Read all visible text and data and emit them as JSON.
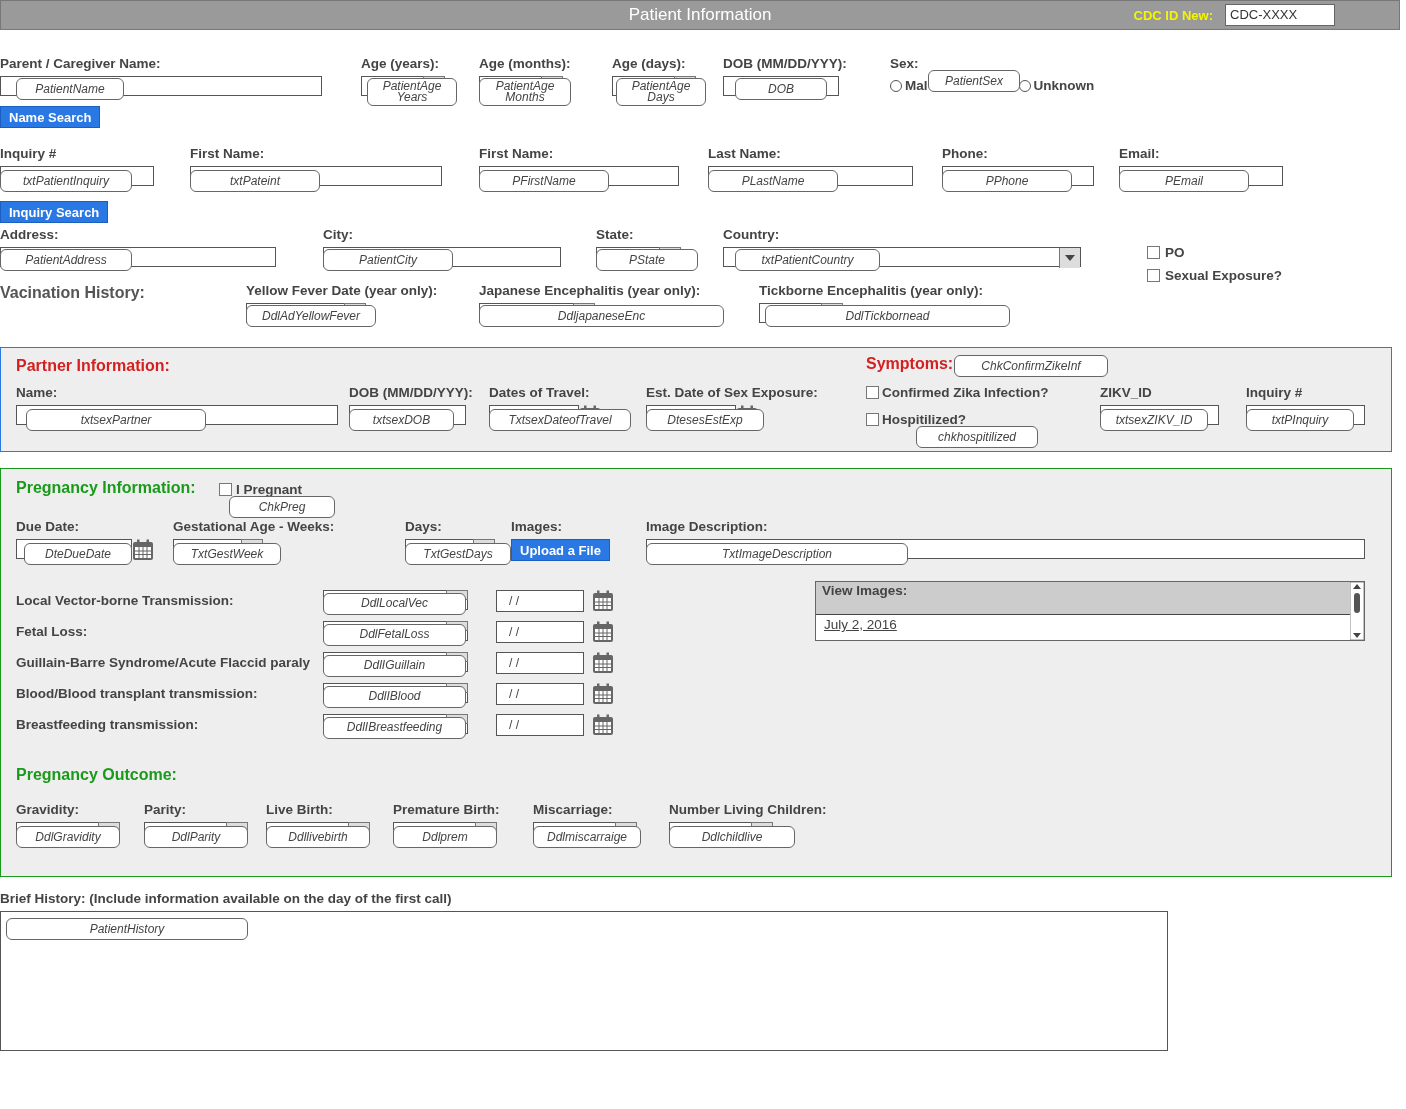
{
  "header": {
    "title": "Patient Information",
    "cdc_label": "CDC ID New:",
    "cdc_value": "CDC-XXXX"
  },
  "patient_row_1": [
    {
      "label": "Parent / Caregiver Name:",
      "kind": "text",
      "callout": "PatientName"
    },
    {
      "label": "Age (years):",
      "kind": "dropdown",
      "callout": "PatientAge Years"
    },
    {
      "label": "Age (months):",
      "kind": "dropdown",
      "callout": "PatientAge Months"
    },
    {
      "label": "Age (days):",
      "kind": "dropdown",
      "callout": "PatientAge Days"
    },
    {
      "label": "DOB (MM/DD/YYY):",
      "kind": "text",
      "callout": "DOB"
    }
  ],
  "sex": {
    "label": "Sex:",
    "callout": "PatientSex",
    "options": [
      {
        "label": "Mal",
        "selected": false
      },
      {
        "label": "Unknown",
        "selected": false
      }
    ]
  },
  "name_search_button": "Name Search",
  "patient_row_2": [
    {
      "label": "Inquiry #",
      "kind": "text",
      "callout": "txtPatientInquiry"
    },
    {
      "label": "First Name:",
      "kind": "text",
      "callout": "txtPateint"
    },
    {
      "label": "First Name:",
      "kind": "text",
      "callout": "PFirstName"
    },
    {
      "label": "Last Name:",
      "kind": "text",
      "callout": "PLastName"
    },
    {
      "label": "Phone:",
      "kind": "text",
      "callout": "PPhone"
    },
    {
      "label": "Email:",
      "kind": "text",
      "callout": "PEmail"
    }
  ],
  "inquiry_search_button": "Inquiry Search",
  "patient_row_3": [
    {
      "label": "Address:",
      "kind": "text",
      "callout": "PatientAddress"
    },
    {
      "label": "City:",
      "kind": "text",
      "callout": "PatientCity"
    },
    {
      "label": "State:",
      "kind": "dropdown",
      "callout": "PState"
    },
    {
      "label": "Country:",
      "kind": "select",
      "callout": "txtPatientCountry"
    }
  ],
  "patient_checks": [
    {
      "label": "PO",
      "checked": false
    },
    {
      "label": "Sexual Exposure?",
      "checked": false
    }
  ],
  "vaccination": {
    "title": "Vacination History:",
    "fields": [
      {
        "label": "Yellow Fever Date (year only):",
        "kind": "dropdown",
        "callout": "DdlAdYellowFever"
      },
      {
        "label": "Japanese Encephalitis (year only):",
        "kind": "dropdown",
        "callout": "DdljapaneseEnc"
      },
      {
        "label": "Tickborne Encephalitis (year only):",
        "kind": "dropdown",
        "callout": "DdlTickbornead"
      }
    ]
  },
  "partner": {
    "title": "Partner Information:",
    "fields": [
      {
        "label": "Name:",
        "kind": "text",
        "callout": "txtsexPartner"
      },
      {
        "label": "DOB (MM/DD/YYY):",
        "kind": "text",
        "callout": "txtsexDOB"
      },
      {
        "label": "Dates of Travel:",
        "kind": "date",
        "callout": "TxtsexDateofTravel"
      },
      {
        "label": "Est. Date of Sex Exposure:",
        "kind": "date",
        "callout": "DtesesEstExp"
      }
    ],
    "symptoms": {
      "title": "Symptoms:",
      "items": [
        {
          "label": "Confirmed Zika Infection?",
          "checked": false,
          "callout": "ChkConfirmZikeInf"
        },
        {
          "label": "Hospitilized?",
          "checked": false,
          "callout": "chkhospitilized"
        }
      ]
    },
    "id_fields": [
      {
        "label": "ZIKV_ID",
        "kind": "text",
        "callout": "txtsexZIKV_ID"
      },
      {
        "label": "Inquiry #",
        "kind": "text",
        "callout": "txtPInquiry"
      }
    ]
  },
  "pregnancy": {
    "title": "Pregnancy Information:",
    "pregnant": {
      "label": "I Pregnant",
      "checked": false,
      "callout": "ChkPreg"
    },
    "fields": [
      {
        "label": "Due Date:",
        "kind": "date",
        "callout": "DteDueDate"
      },
      {
        "label": "Gestational Age - Weeks:",
        "kind": "dropdown",
        "callout": "TxtGestWeek"
      },
      {
        "label": "Days:",
        "kind": "dropdown",
        "callout": "TxtGestDays"
      }
    ],
    "images_label": "Images:",
    "upload_button": "Upload a File",
    "description": {
      "label": "Image Description:",
      "kind": "text",
      "callout": "TxtImageDescription"
    },
    "transmissions": [
      {
        "label": "Local Vector-borne Transmission:",
        "callout": "DdlLocalVec",
        "date": "/  /"
      },
      {
        "label": "Fetal Loss:",
        "callout": "DdlFetalLoss",
        "date": "/  /"
      },
      {
        "label": "Guillain-Barre Syndrome/Acute Flaccid paraly",
        "callout": "DdlIGuillain",
        "date": "/  /"
      },
      {
        "label": "Blood/Blood transplant transmission:",
        "callout": "DdlIBlood",
        "date": "/  /"
      },
      {
        "label": "Breastfeeding transmission:",
        "callout": "DdlIBreastfeeding",
        "date": "/  /"
      }
    ],
    "view_images": {
      "title": "View Images:",
      "items": [
        "July 2, 2016"
      ]
    },
    "outcome": {
      "title": "Pregnancy Outcome:",
      "fields": [
        {
          "label": "Gravidity:",
          "kind": "dropdown",
          "callout": "DdlGravidity"
        },
        {
          "label": "Parity:",
          "kind": "dropdown",
          "callout": "DdlParity"
        },
        {
          "label": "Live Birth:",
          "kind": "dropdown",
          "callout": "Ddllivebirth"
        },
        {
          "label": "Premature Birth:",
          "kind": "dropdown",
          "callout": "Ddlprem"
        },
        {
          "label": "Miscarriage:",
          "kind": "dropdown",
          "callout": "Ddlmiscarraige"
        },
        {
          "label": "Number Living Children:",
          "kind": "dropdown",
          "callout": "Ddlchildlive"
        }
      ]
    }
  },
  "history": {
    "label": "Brief History: (Include information available on the day of the first call)",
    "callout": "PatientHistory"
  }
}
